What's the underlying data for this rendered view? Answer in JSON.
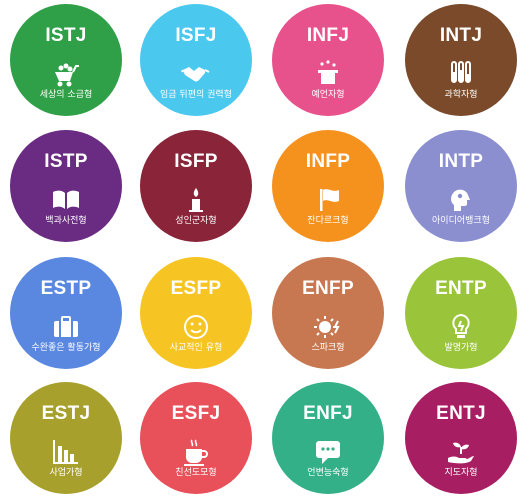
{
  "types": [
    {
      "code": "ISTJ",
      "label": "세상의 소금형",
      "color": "#2fa048",
      "icon": "cart-icon"
    },
    {
      "code": "ISFJ",
      "label": "임금 뒤편의 권력형",
      "color": "#4ac8ee",
      "icon": "handshake-icon"
    },
    {
      "code": "INFJ",
      "label": "예언자형",
      "color": "#e8528c",
      "icon": "magic-hat-icon"
    },
    {
      "code": "INTJ",
      "label": "과학자형",
      "color": "#7a4a2a",
      "icon": "test-tubes-icon"
    },
    {
      "code": "ISTP",
      "label": "백과사전형",
      "color": "#6a2c82",
      "icon": "open-book-icon"
    },
    {
      "code": "ISFP",
      "label": "성인군자형",
      "color": "#8a2438",
      "icon": "candle-icon"
    },
    {
      "code": "INFP",
      "label": "잔다르크형",
      "color": "#f5921e",
      "icon": "flag-icon"
    },
    {
      "code": "INTP",
      "label": "아이디어뱅크형",
      "color": "#8b8fd0",
      "icon": "idea-head-icon"
    },
    {
      "code": "ESTP",
      "label": "수완좋은 활동가형",
      "color": "#5a88e0",
      "icon": "suitcase-icon"
    },
    {
      "code": "ESFP",
      "label": "사교적인 유형",
      "color": "#f7c523",
      "icon": "smiley-icon"
    },
    {
      "code": "ENFP",
      "label": "스파크형",
      "color": "#c87850",
      "icon": "sun-spark-icon"
    },
    {
      "code": "ENTP",
      "label": "발명가형",
      "color": "#9ac43a",
      "icon": "lightbulb-icon"
    },
    {
      "code": "ESTJ",
      "label": "사업가형",
      "color": "#a8a02c",
      "icon": "bar-chart-icon"
    },
    {
      "code": "ESFJ",
      "label": "친선도모형",
      "color": "#e8505a",
      "icon": "coffee-cup-icon"
    },
    {
      "code": "ENFJ",
      "label": "언변능숙형",
      "color": "#34b088",
      "icon": "speech-bubble-icon"
    },
    {
      "code": "ENTJ",
      "label": "지도자형",
      "color": "#a81e62",
      "icon": "plant-hand-icon"
    }
  ]
}
